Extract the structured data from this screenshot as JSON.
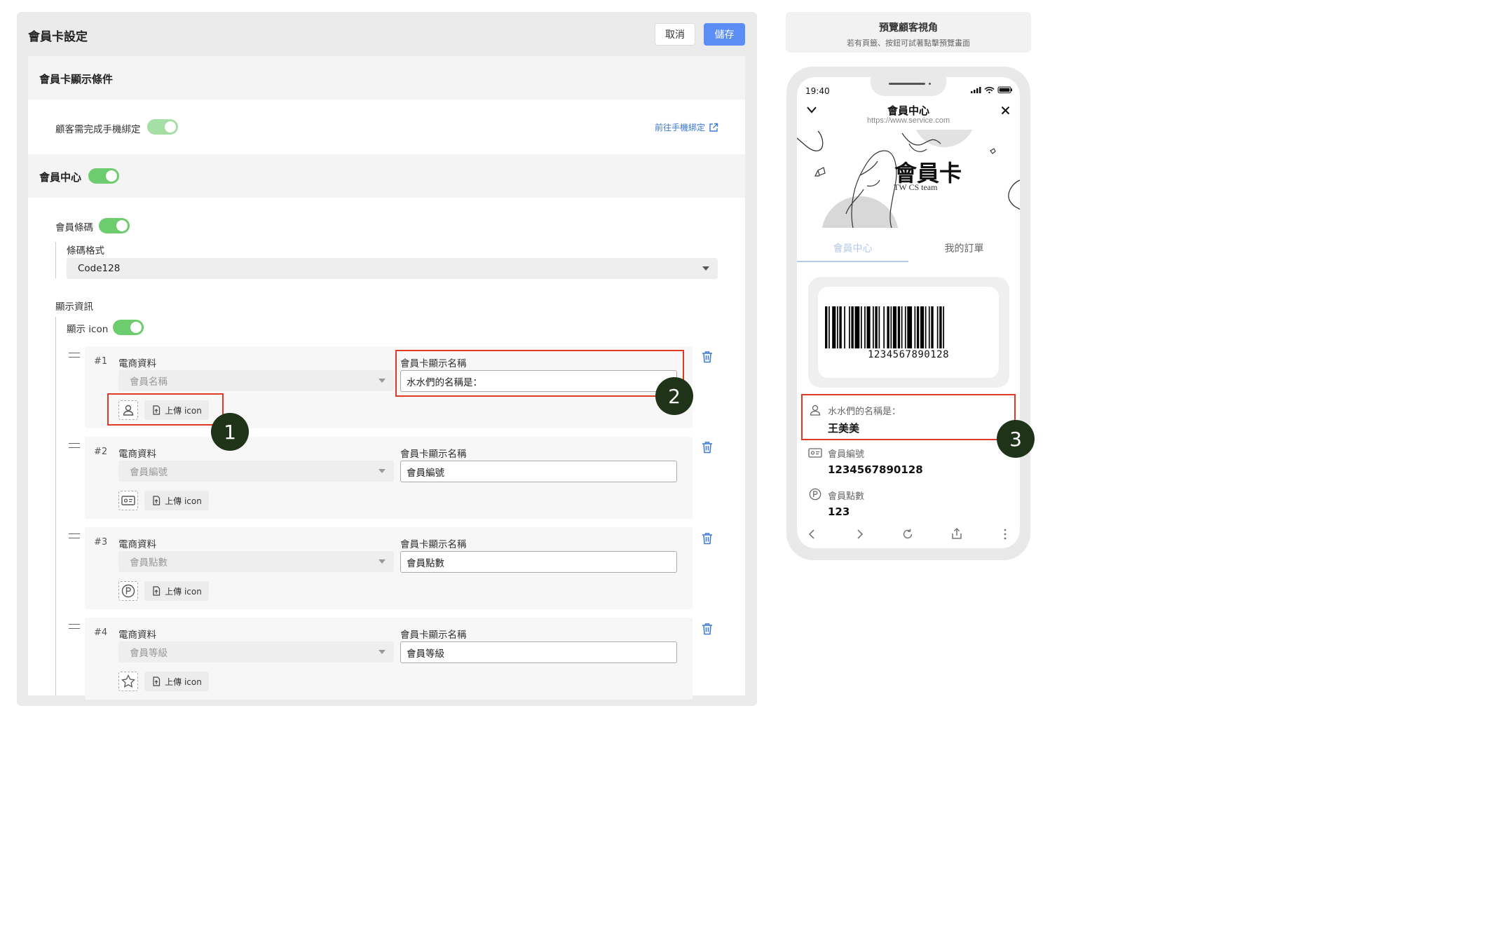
{
  "settings": {
    "title": "會員卡設定",
    "cancel_label": "取消",
    "save_label": "儲存",
    "display_conditions": {
      "heading": "會員卡顯示條件",
      "phone_binding_label": "顧客需完成手機綁定",
      "phone_binding_on": true,
      "phone_binding_link": "前往手機綁定"
    },
    "member_center": {
      "heading": "會員中心",
      "enabled": true,
      "barcode_label": "會員條碼",
      "barcode_on": true,
      "barcode_format_label": "條碼格式",
      "barcode_format_value": "Code128",
      "display_info_label": "顯示資訊",
      "show_icon_label": "顯示 icon",
      "show_icon_on": true
    },
    "field_label_left": "電商資料",
    "field_label_right": "會員卡顯示名稱",
    "upload_label": "上傳 icon",
    "rows": [
      {
        "index": "#1",
        "source": "會員名稱",
        "display_name": "水水們的名稱是：",
        "icon": "person-icon"
      },
      {
        "index": "#2",
        "source": "會員編號",
        "display_name": "會員編號",
        "icon": "id-card-icon"
      },
      {
        "index": "#3",
        "source": "會員點數",
        "display_name": "會員點數",
        "icon": "points-icon"
      },
      {
        "index": "#4",
        "source": "會員等級",
        "display_name": "會員等級",
        "icon": "star-icon"
      }
    ]
  },
  "preview": {
    "heading": "預覽顧客視角",
    "subheading": "若有頁籤、按鈕可試著點擊預覽畫面",
    "status_time": "19:40",
    "page_title": "會員中心",
    "url": "https://www.service.com",
    "banner_title": "會員卡",
    "banner_subtitle": "TW CS team",
    "tabs": [
      "會員中心",
      "我的訂單"
    ],
    "active_tab": 0,
    "barcode_number": "1234567890128",
    "info": [
      {
        "label": "水水們的名稱是：",
        "value": "王美美",
        "icon": "person-icon"
      },
      {
        "label": "會員編號",
        "value": "1234567890128",
        "icon": "id-card-icon"
      },
      {
        "label": "會員點數",
        "value": "123",
        "icon": "points-icon"
      }
    ]
  },
  "annotations": [
    "1",
    "2",
    "3"
  ],
  "colors": {
    "accent": "#5b8ef4",
    "toggle_on": "#6dcc6d",
    "highlight": "#e03a26",
    "badge": "#1e3318"
  }
}
